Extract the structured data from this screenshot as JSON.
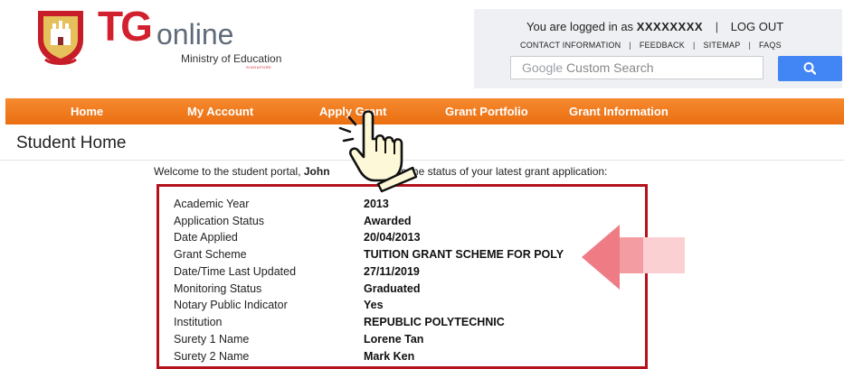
{
  "header": {
    "logo_tg": "TG",
    "logo_online": "online",
    "ministry": "Ministry of Education",
    "ministry_sub": "SINGAPORE",
    "logged_in_prefix": "You are logged in as",
    "username": "XXXXXXXX",
    "divider": "|",
    "logout_label": "LOG OUT",
    "links": {
      "contact": "CONTACT INFORMATION",
      "feedback": "FEEDBACK",
      "sitemap": "SITEMAP",
      "faqs": "FAQS"
    },
    "search": {
      "google": "Google",
      "placeholder": "Custom Search"
    }
  },
  "nav": [
    "Home",
    "My Account",
    "Apply Grant",
    "Grant Portfolio",
    "Grant Information"
  ],
  "page_title": "Student Home",
  "welcome": {
    "before": "Welcome to the student portal, ",
    "name": "John",
    "after": "below is the status of your latest grant application:"
  },
  "status": [
    {
      "label": "Academic Year",
      "value": "2013"
    },
    {
      "label": "Application Status",
      "value": "Awarded"
    },
    {
      "label": "Date Applied",
      "value": "20/04/2013"
    },
    {
      "label": "Grant Scheme",
      "value": "TUITION GRANT SCHEME FOR POLY"
    },
    {
      "label": "Date/Time Last Updated",
      "value": "27/11/2019"
    },
    {
      "label": "Monitoring Status",
      "value": "Graduated"
    },
    {
      "label": "Notary Public Indicator",
      "value": "Yes"
    },
    {
      "label": "Institution",
      "value": "REPUBLIC POLYTECHNIC"
    },
    {
      "label": "Surety 1 Name",
      "value": "Lorene Tan"
    },
    {
      "label": "Surety 2 Name",
      "value": "Mark Ken"
    }
  ],
  "colors": {
    "brand_red": "#d3202e",
    "nav_orange": "#f07c20",
    "box_border": "#b3121b",
    "search_blue": "#4285f4",
    "arrow_pink": "#f08a90"
  },
  "icons": {
    "crest": "coat-of-arms-icon",
    "search": "magnifier-icon",
    "pointer": "pointing-hand-icon",
    "arrow": "left-arrow-icon"
  }
}
